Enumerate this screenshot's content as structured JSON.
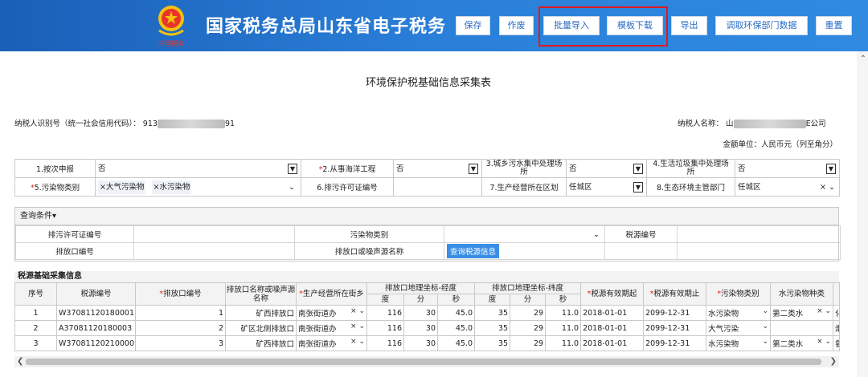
{
  "header": {
    "title": "国家税务总局山东省电子税务",
    "emblem_text": "中国税务",
    "buttons": [
      "保存",
      "作废",
      "批量导入",
      "模板下载",
      "导出",
      "调取环保部门数据",
      "重置"
    ]
  },
  "page_title": "环境保护税基础信息采集表",
  "taxpayer": {
    "id_label": "纳税人识别号（统一社会信用代码）：",
    "id_prefix": "913",
    "id_suffix": "91",
    "name_label": "纳税人名称：",
    "name_prefix": "山",
    "name_suffix": "E公司",
    "unit": "金额单位：人民币元（列至角分）"
  },
  "form": {
    "r1": [
      {
        "label": "1.按次申报",
        "req": "",
        "value": "否"
      },
      {
        "label": "2.从事海洋工程",
        "req": "*",
        "value": "否"
      },
      {
        "label": "3.城乡污水集中处理场所",
        "req": "",
        "value": "否"
      },
      {
        "label": "4.生活垃圾集中处理场所",
        "req": "",
        "value": "否"
      }
    ],
    "r2": {
      "l5": "5.污染物类别",
      "req5": "*",
      "tag1": "×大气污染物",
      "tag2": "×水污染物",
      "l6": "6.排污许可证编号",
      "v6": "",
      "l7": "7.生产经营所在区划",
      "v7": "任城区",
      "l8": "8.生态环境主管部门",
      "v8": "任城区"
    }
  },
  "query": {
    "title": "查询条件▾",
    "f1": "排污许可证编号",
    "f2": "污染物类别",
    "f3": "税源编号",
    "f4": "排放口编号",
    "f5": "排放口或噪声源名称",
    "btn": "查询税源信息"
  },
  "table": {
    "title": "税源基础采集信息",
    "headers": {
      "seq": "序号",
      "code": "税源编号",
      "outlet": "排放口编号",
      "name": "排放口名称或噪声源名称",
      "street": "生产经营所在街乡",
      "lng": "排放口地理坐标-经度",
      "lat": "排放口地理坐标-纬度",
      "deg": "度",
      "min": "分",
      "sec": "秒",
      "start": "税源有效期起",
      "end": "税源有效期止",
      "ptype": "污染物类别",
      "wtype": "水污染物种类"
    },
    "rows": [
      {
        "seq": "1",
        "code": "W37081120180001",
        "outlet": "1",
        "name": "矿西排放口",
        "street": "南张街道办",
        "lng_d": "116",
        "lng_m": "30",
        "lng_s": "45.0",
        "lat_d": "35",
        "lat_m": "29",
        "lat_s": "11.0",
        "start": "2018-01-01",
        "end": "2099-12-31",
        "ptype": "水污染物",
        "wtype": "第二类水",
        "extra": "化"
      },
      {
        "seq": "2",
        "code": "A37081120180003",
        "outlet": "2",
        "name": "矿区北侧排放口",
        "street": "南张街道办",
        "lng_d": "116",
        "lng_m": "30",
        "lng_s": "45.0",
        "lat_d": "35",
        "lat_m": "29",
        "lat_s": "11.0",
        "start": "2018-01-01",
        "end": "2099-12-31",
        "ptype": "大气污染",
        "wtype": "",
        "extra": "烟"
      },
      {
        "seq": "3",
        "code": "W37081120210000",
        "outlet": "3",
        "name": "矿西排放口",
        "street": "南张街道办",
        "lng_d": "116",
        "lng_m": "30",
        "lng_s": "45.0",
        "lat_d": "35",
        "lat_m": "29",
        "lat_s": "11.0",
        "start": "2018-01-01",
        "end": "2099-12-31",
        "ptype": "水污染物",
        "wtype": "第二类水",
        "extra": "氨"
      }
    ]
  },
  "colors": {
    "header": "#2a7fd8",
    "highlight": "#e0191e",
    "required": "#e02020"
  }
}
